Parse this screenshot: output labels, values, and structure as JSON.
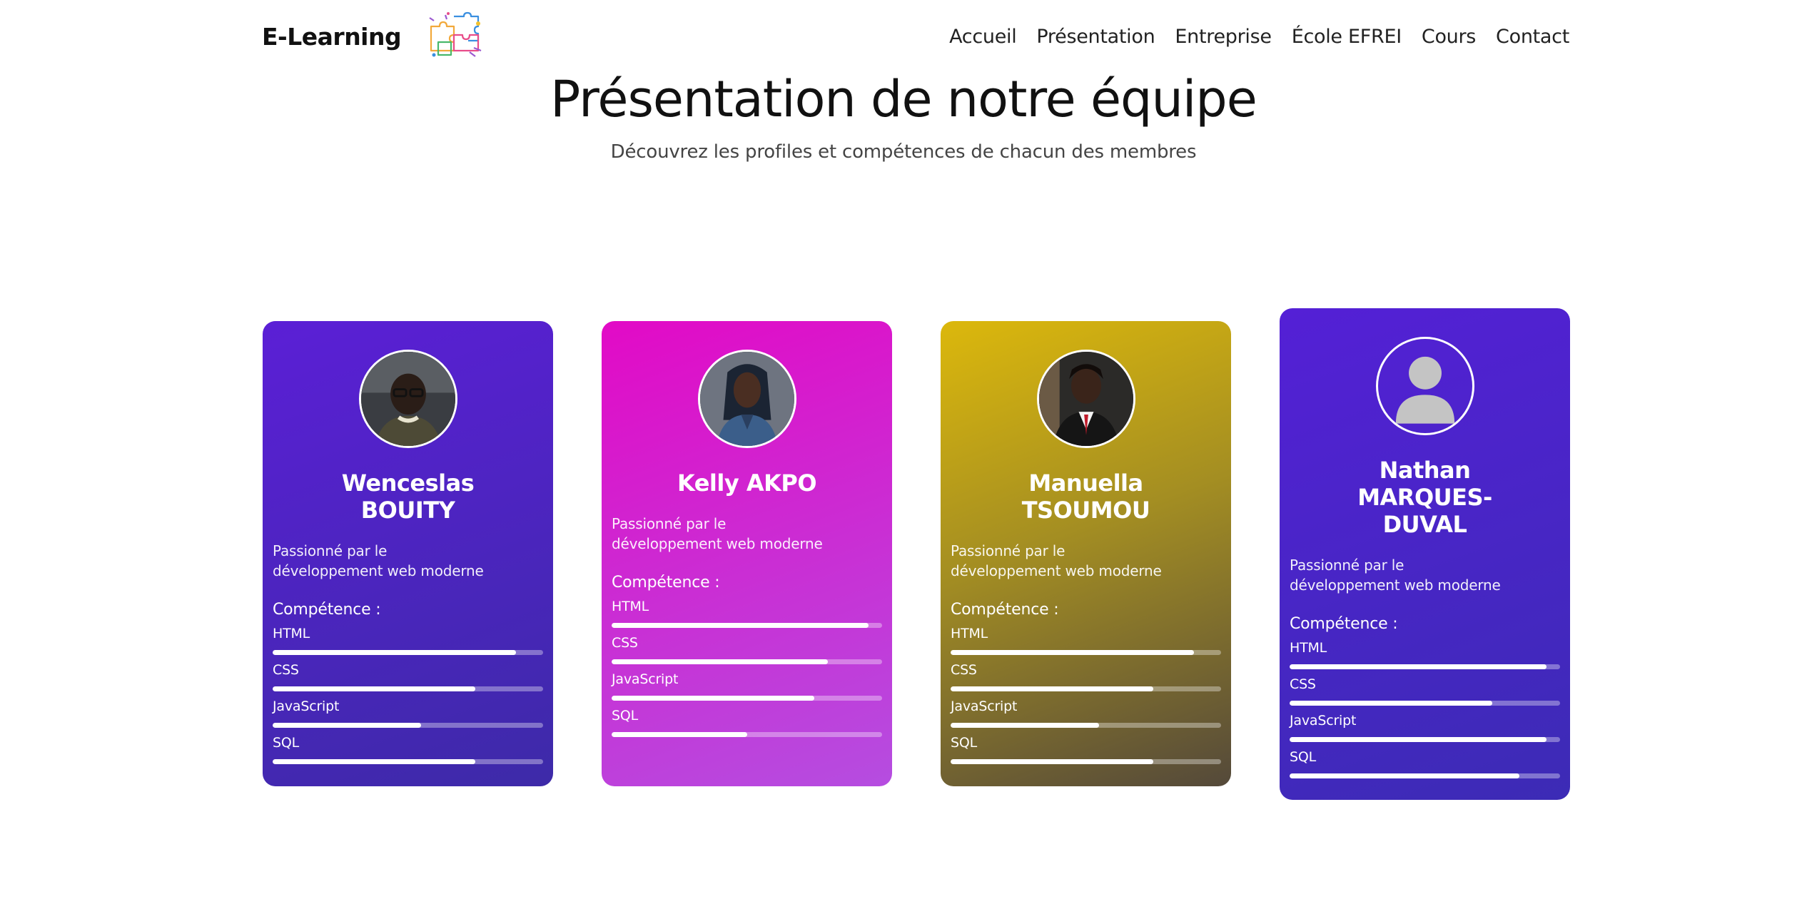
{
  "navbar": {
    "brand": "E-Learning",
    "links": [
      "Accueil",
      "Présentation",
      "Entreprise",
      "École EFREI",
      "Cours",
      "Contact"
    ]
  },
  "hero": {
    "title": "Présentation de notre équipe",
    "subtitle": "Découvrez les profiles et compétences de chacun des membres"
  },
  "members": [
    {
      "name": "Wenceslas BOUITY",
      "description": "Passionné par le développement web moderne",
      "skills_title": "Compétence :",
      "skills": [
        {
          "label": "HTML",
          "level": 0.9
        },
        {
          "label": "CSS",
          "level": 0.75
        },
        {
          "label": "JavaScript",
          "level": 0.55
        },
        {
          "label": "SQL",
          "level": 0.75
        }
      ],
      "gradient": [
        "#5b1fd6",
        "#3d2aa8"
      ],
      "avatar": "photo"
    },
    {
      "name": "Kelly AKPO",
      "description": "Passionné par le développement web moderne",
      "skills_title": "Compétence :",
      "skills": [
        {
          "label": "HTML",
          "level": 0.95
        },
        {
          "label": "CSS",
          "level": 0.8
        },
        {
          "label": "JavaScript",
          "level": 0.75
        },
        {
          "label": "SQL",
          "level": 0.5
        }
      ],
      "gradient": [
        "#e20ac6",
        "#b54de0"
      ],
      "avatar": "photo"
    },
    {
      "name": "Manuella TSOUMOU",
      "description": "Passionné par le développement web moderne",
      "skills_title": "Compétence :",
      "skills": [
        {
          "label": "HTML",
          "level": 0.9
        },
        {
          "label": "CSS",
          "level": 0.75
        },
        {
          "label": "JavaScript",
          "level": 0.55
        },
        {
          "label": "SQL",
          "level": 0.75
        }
      ],
      "gradient": [
        "#dcb80c",
        "#54493a"
      ],
      "avatar": "photo"
    },
    {
      "name": "Nathan MARQUES-DUVAL",
      "description": "Passionné par le développement web moderne",
      "skills_title": "Compétence :",
      "skills": [
        {
          "label": "HTML",
          "level": 0.95
        },
        {
          "label": "CSS",
          "level": 0.75
        },
        {
          "label": "JavaScript",
          "level": 0.95
        },
        {
          "label": "SQL",
          "level": 0.85
        }
      ],
      "gradient": [
        "#5420d6",
        "#3c2bb5"
      ],
      "avatar": "default-user-icon"
    }
  ]
}
